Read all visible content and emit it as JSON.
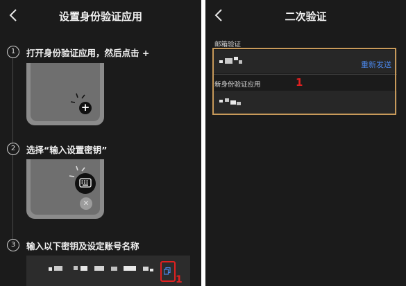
{
  "left_screen": {
    "title": "设置身份验证应用",
    "steps": [
      {
        "number": "1",
        "text": "打开身份验证应用，然后点击 +"
      },
      {
        "number": "2",
        "text": "选择“输入设置密钥”"
      },
      {
        "number": "3",
        "text": "输入以下密钥及设定账号名称"
      }
    ],
    "plus_symbol": "+",
    "close_symbol": "✕",
    "annotation_number": "1"
  },
  "right_screen": {
    "title": "二次验证",
    "email_label": "邮箱验证",
    "resend_label": "重新发送",
    "new_app_label": "新身份验证应用",
    "annotation_number": "1"
  },
  "colors": {
    "background": "#1b1b1b",
    "link_blue": "#4a86e8",
    "annotation_red": "#e02020",
    "highlight_border": "#c89a5a"
  },
  "icons": [
    "back-arrow-icon",
    "plus-icon",
    "keyboard-icon",
    "close-icon",
    "copy-icon"
  ]
}
